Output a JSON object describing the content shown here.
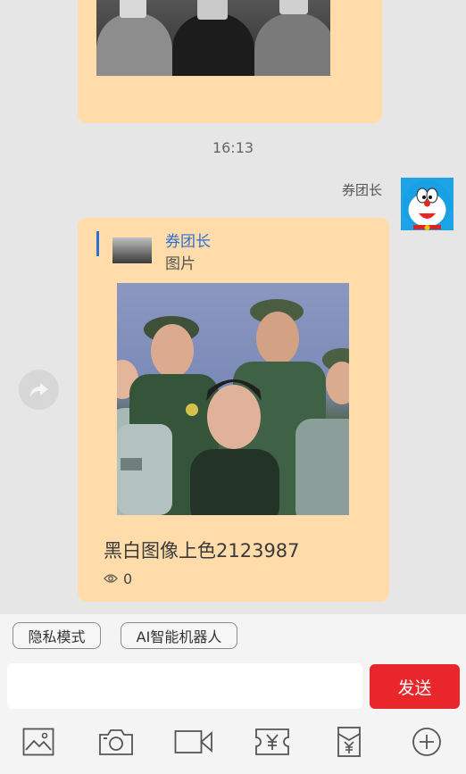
{
  "chat": {
    "timestamp": "16:13",
    "message": {
      "sender_name": "券团长",
      "quote": {
        "name": "券团长",
        "type": "图片"
      },
      "caption": "黑白图像上色2123987",
      "views": "0"
    }
  },
  "input": {
    "chips": [
      "隐私模式",
      "AI智能机器人"
    ],
    "text_value": "",
    "send_label": "发送"
  },
  "toolbar": {
    "icons": [
      "image-icon",
      "camera-icon",
      "video-icon",
      "coupon-icon",
      "red-packet-icon",
      "plus-icon"
    ]
  },
  "colors": {
    "bubble": "#ffdcaa",
    "quote_accent": "#2f6fd1",
    "send_button": "#e8262b",
    "background": "#e6e6e6"
  }
}
